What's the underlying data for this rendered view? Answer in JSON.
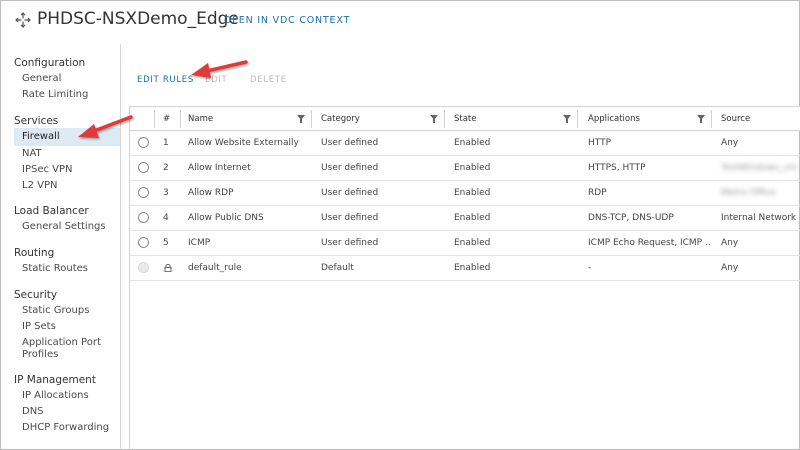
{
  "header": {
    "title": "PHDSC-NSXDemo_Edge",
    "vdc_link": "OPEN IN VDC CONTEXT"
  },
  "sidebar": {
    "groups": [
      {
        "label": "Configuration",
        "items": [
          "General",
          "Rate Limiting"
        ]
      },
      {
        "label": "Services",
        "items": [
          "Firewall",
          "NAT",
          "IPSec VPN",
          "L2 VPN"
        ]
      },
      {
        "label": "Load Balancer",
        "items": [
          "General Settings"
        ]
      },
      {
        "label": "Routing",
        "items": [
          "Static Routes"
        ]
      },
      {
        "label": "Security",
        "items": [
          "Static Groups",
          "IP Sets",
          "Application Port",
          "Profiles"
        ]
      },
      {
        "label": "IP Management",
        "items": [
          "IP Allocations",
          "DNS",
          "DHCP Forwarding"
        ]
      }
    ],
    "active_item": "Firewall"
  },
  "toolbar": {
    "edit_rules": "EDIT RULES",
    "edit": "EDIT",
    "delete": "DELETE"
  },
  "grid": {
    "columns": [
      "#",
      "Name",
      "Category",
      "State",
      "Applications",
      "Source"
    ],
    "rows": [
      {
        "num": "1",
        "name": "Allow Website Externally",
        "category": "User defined",
        "state": "Enabled",
        "applications": "HTTP",
        "source": "Any"
      },
      {
        "num": "2",
        "name": "Allow Internet",
        "category": "User defined",
        "state": "Enabled",
        "applications": "HTTPS, HTTP",
        "source": "TestWindows_vm"
      },
      {
        "num": "3",
        "name": "Allow RDP",
        "category": "User defined",
        "state": "Enabled",
        "applications": "RDP",
        "source": "Metro Office"
      },
      {
        "num": "4",
        "name": "Allow Public DNS",
        "category": "User defined",
        "state": "Enabled",
        "applications": "DNS-TCP, DNS-UDP",
        "source": "Internal Network"
      },
      {
        "num": "5",
        "name": "ICMP",
        "category": "User defined",
        "state": "Enabled",
        "applications": "ICMP Echo Request, ICMP ...",
        "source": "Any"
      },
      {
        "num": "",
        "name": "default_rule",
        "category": "Default",
        "state": "Enabled",
        "applications": "-",
        "source": "Any"
      }
    ]
  },
  "colors": {
    "link_blue": "#1b6fa8",
    "active_bg": "#dde9f3",
    "annotation_red": "#e03a3a",
    "border": "#d4d4d4"
  },
  "icons": {
    "edge": "edge-gateway-icon",
    "filter": "filter-icon",
    "lock": "lock-icon",
    "radio": "radio-button"
  }
}
